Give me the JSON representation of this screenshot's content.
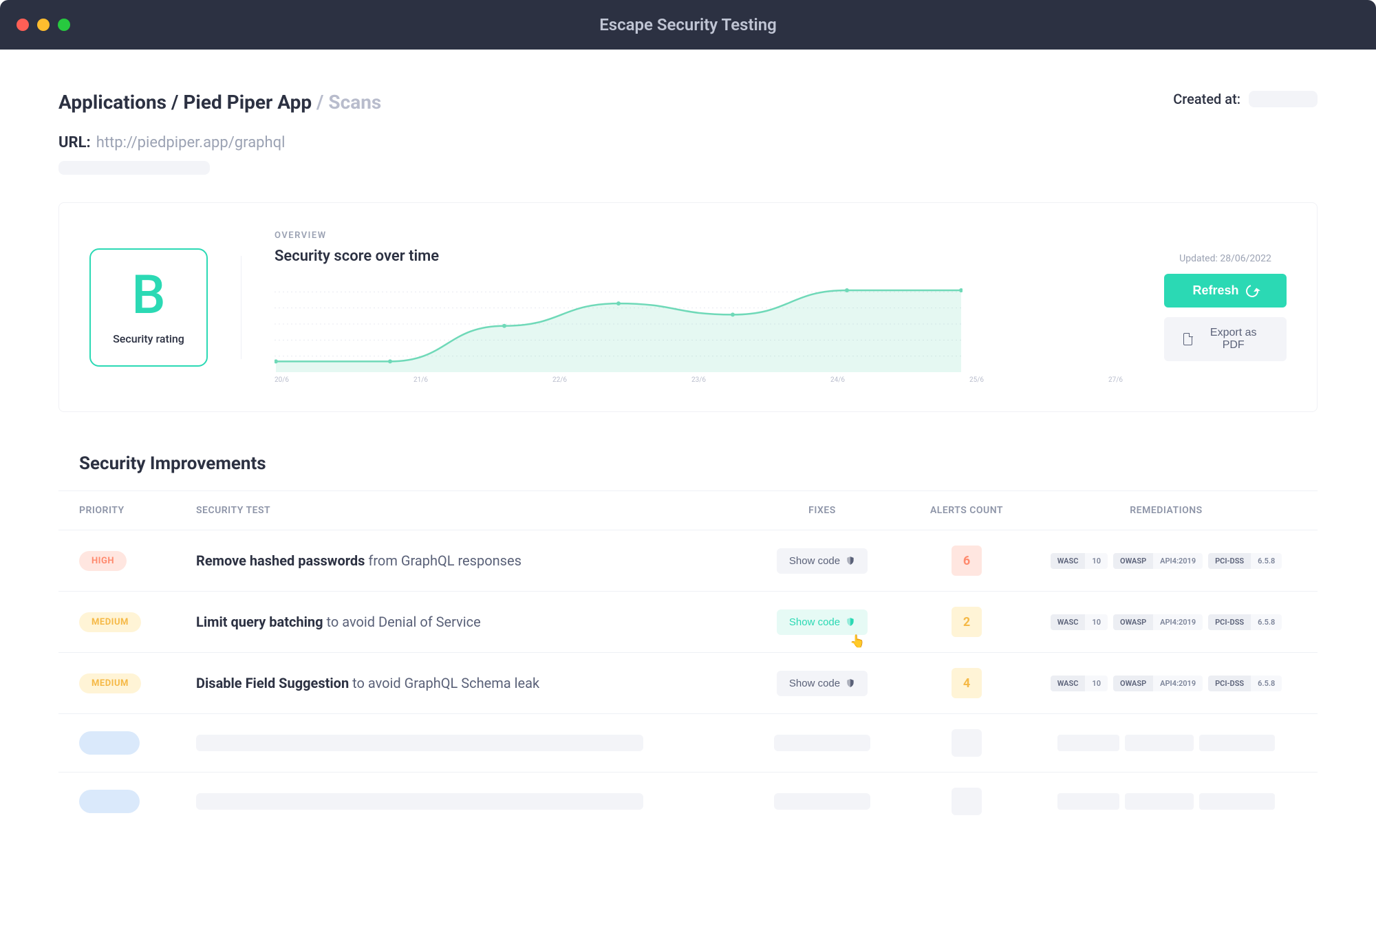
{
  "window": {
    "title": "Escape Security Testing"
  },
  "breadcrumb": {
    "root": "Applications",
    "app": "Pied Piper App",
    "page": "Scans"
  },
  "meta": {
    "created_label": "Created at:"
  },
  "url": {
    "label": "URL:",
    "value": "http://piedpiper.app/graphql"
  },
  "overview": {
    "label": "OVERVIEW",
    "chart_title": "Security score over time",
    "rating": {
      "grade": "B",
      "label": "Security rating"
    },
    "updated": "Updated: 28/06/2022",
    "refresh_label": "Refresh",
    "export_label": "Export as PDF"
  },
  "chart_data": {
    "type": "area",
    "xlabel": "",
    "ylabel": "Security score",
    "title": "Security score over time",
    "categories": [
      "20/6",
      "21/6",
      "22/6",
      "23/6",
      "24/6",
      "25/6",
      "27/6"
    ],
    "values": [
      10,
      10,
      48,
      72,
      60,
      86,
      86
    ],
    "ylim": [
      0,
      100
    ]
  },
  "improvements": {
    "title": "Security Improvements",
    "columns": {
      "priority": "PRIORITY",
      "test": "SECURITY TEST",
      "fixes": "FIXES",
      "alerts": "ALERTS COUNT",
      "rem": "REMEDIATIONS"
    },
    "show_code": "Show code",
    "rows": [
      {
        "priority": "HIGH",
        "test_strong": "Remove hashed passwords",
        "test_rest": " from GraphQL responses",
        "alerts": "6",
        "rem": [
          {
            "k": "WASC",
            "v": "10"
          },
          {
            "k": "OWASP",
            "v": "API4:2019"
          },
          {
            "k": "PCI-DSS",
            "v": "6.5.8"
          }
        ]
      },
      {
        "priority": "MEDIUM",
        "test_strong": "Limit query batching",
        "test_rest": " to avoid Denial of Service",
        "alerts": "2",
        "rem": [
          {
            "k": "WASC",
            "v": "10"
          },
          {
            "k": "OWASP",
            "v": "API4:2019"
          },
          {
            "k": "PCI-DSS",
            "v": "6.5.8"
          }
        ]
      },
      {
        "priority": "MEDIUM",
        "test_strong": "Disable Field Suggestion",
        "test_rest": " to avoid GraphQL Schema leak",
        "alerts": "4",
        "rem": [
          {
            "k": "WASC",
            "v": "10"
          },
          {
            "k": "OWASP",
            "v": "API4:2019"
          },
          {
            "k": "PCI-DSS",
            "v": "6.5.8"
          }
        ]
      }
    ]
  }
}
